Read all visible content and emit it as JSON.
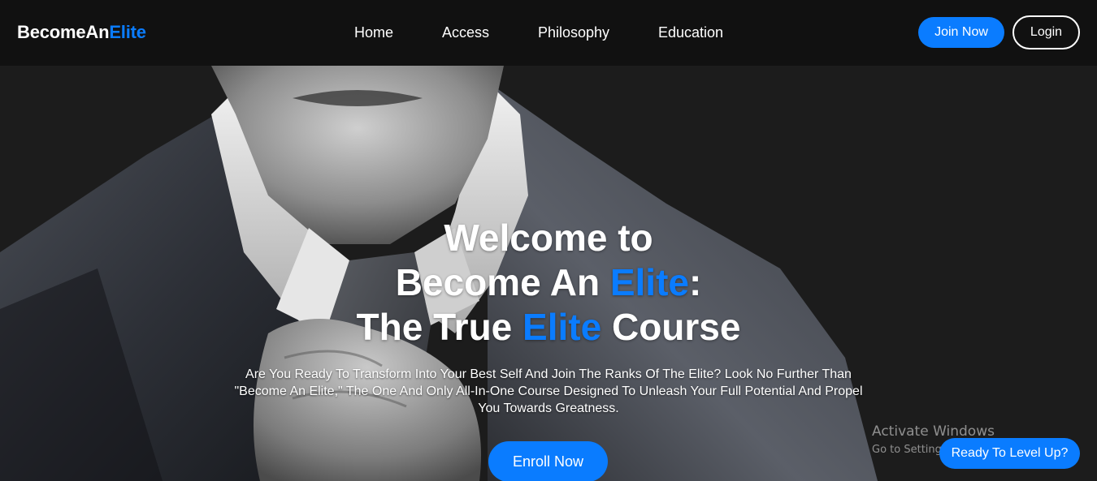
{
  "header": {
    "logo": {
      "primary": "BecomeAn",
      "accent": "Elite"
    },
    "nav": [
      {
        "label": "Home"
      },
      {
        "label": "Access"
      },
      {
        "label": "Philosophy"
      },
      {
        "label": "Education"
      }
    ],
    "join_label": "Join Now",
    "login_label": "Login"
  },
  "hero": {
    "line1": "Welcome to",
    "line2_pre": "Become An ",
    "line2_accent": "Elite",
    "line2_post": ":",
    "line3_pre": "The True ",
    "line3_accent": "Elite",
    "line3_post": " Course",
    "subtitle": "Are You Ready To Transform Into Your Best Self And Join The Ranks Of The Elite? Look No Further Than \"Become An Elite,\" The One And Only All-In-One Course Designed To Unleash Your Full Potential And Propel You Towards Greatness.",
    "enroll_label": "Enroll Now"
  },
  "watermark": {
    "title": "Activate Windows",
    "subtitle": "Go to Settings to activate Windows."
  },
  "chat_button_label": "Ready To Level Up?",
  "colors": {
    "accent": "#0a7cff",
    "header_bg": "#111111",
    "page_bg": "#1c1c1c"
  }
}
